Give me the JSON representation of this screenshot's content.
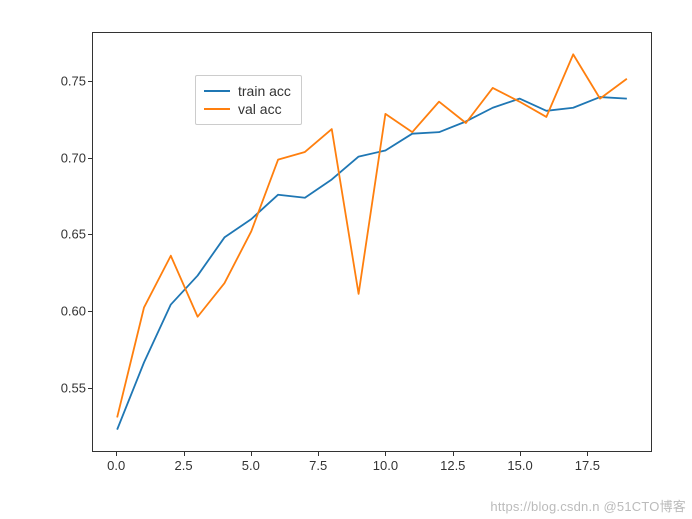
{
  "chart_data": {
    "type": "line",
    "x": [
      0,
      1,
      2,
      3,
      4,
      5,
      6,
      7,
      8,
      9,
      10,
      11,
      12,
      13,
      14,
      15,
      16,
      17,
      18,
      19
    ],
    "series": [
      {
        "name": "train acc",
        "color": "#1f77b4",
        "values": [
          0.522,
          0.566,
          0.604,
          0.623,
          0.648,
          0.66,
          0.676,
          0.674,
          0.686,
          0.701,
          0.705,
          0.716,
          0.717,
          0.724,
          0.733,
          0.739,
          0.731,
          0.733,
          0.74,
          0.739
        ]
      },
      {
        "name": "val acc",
        "color": "#ff7f0e",
        "values": [
          0.53,
          0.602,
          0.636,
          0.596,
          0.618,
          0.652,
          0.699,
          0.704,
          0.719,
          0.611,
          0.729,
          0.717,
          0.737,
          0.723,
          0.746,
          0.737,
          0.727,
          0.768,
          0.739,
          0.752
        ]
      }
    ],
    "xlabel": "",
    "ylabel": "",
    "xlim": [
      -0.9,
      19.9
    ],
    "ylim": [
      0.508,
      0.782
    ],
    "xticks": [
      0.0,
      2.5,
      5.0,
      7.5,
      10.0,
      12.5,
      15.0,
      17.5
    ],
    "yticks": [
      0.55,
      0.6,
      0.65,
      0.7,
      0.75
    ],
    "legend_pos": "upper left"
  },
  "legend": {
    "train": "train acc",
    "val": "val acc"
  },
  "xtick_labels": [
    "0.0",
    "2.5",
    "5.0",
    "7.5",
    "10.0",
    "12.5",
    "15.0",
    "17.5"
  ],
  "ytick_labels": [
    "0.55",
    "0.60",
    "0.65",
    "0.70",
    "0.75"
  ],
  "watermark": "https://blog.csdn.n @51CTO博客"
}
